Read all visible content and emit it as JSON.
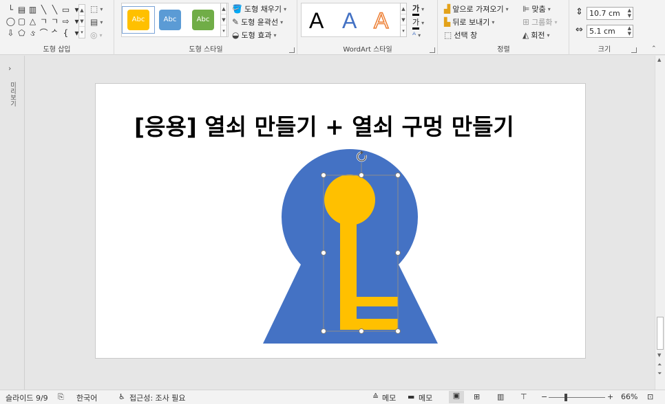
{
  "ribbon": {
    "insert_shapes": {
      "label": "도형 삽입",
      "shapes": [
        "└",
        "▤",
        "▥",
        "╲",
        "╲",
        "▭",
        "▾",
        "◯",
        "▢",
        "△",
        "ㄱ",
        "ㄱ",
        "⇨",
        "▾",
        "⇩",
        "⬠",
        "ઙ",
        "⌒",
        "ᄼ",
        "{",
        "▾"
      ],
      "edit_shape_icon": "edit-shape-icon",
      "textbox_icon": "textbox-icon",
      "merge_icon": "merge-shapes-icon"
    },
    "shape_styles": {
      "label": "도형 스타일",
      "tiles": [
        {
          "text": "Abc",
          "color": "#FFC000",
          "selected": true
        },
        {
          "text": "Abc",
          "color": "#5B9BD5",
          "selected": false
        },
        {
          "text": "Abc",
          "color": "#70AD47",
          "selected": false
        }
      ],
      "fill": "도형 채우기",
      "outline": "도형 윤곽선",
      "effects": "도형 효과"
    },
    "wordart": {
      "label": "WordArt 스타일",
      "letters": [
        {
          "text": "A",
          "color": "#000000"
        },
        {
          "text": "A",
          "color": "#4472C4"
        },
        {
          "text": "A",
          "color": "#F4B183"
        }
      ],
      "text_fill_glyph": "가",
      "text_outline_glyph": "가"
    },
    "arrange": {
      "label": "정렬",
      "bring_forward": "앞으로 가져오기",
      "send_backward": "뒤로 보내기",
      "selection_pane": "선택 창",
      "align": "맞춤",
      "group": "그룹화",
      "rotate": "회전"
    },
    "size": {
      "label": "크기",
      "height": "10.7 cm",
      "width": "5.1 cm"
    }
  },
  "left_pane": {
    "label": "미리보기"
  },
  "slide": {
    "title": "[응용] 열쇠 만들기 + 열쇠 구멍 만들기"
  },
  "colors": {
    "keyhole": "#4472C4",
    "key": "#FFC000"
  },
  "status": {
    "slide_info": "슬라이드 9/9",
    "language": "한국어",
    "accessibility": "접근성: 조사 필요",
    "notes": "메모",
    "comments": "메모",
    "zoom": "66%"
  }
}
